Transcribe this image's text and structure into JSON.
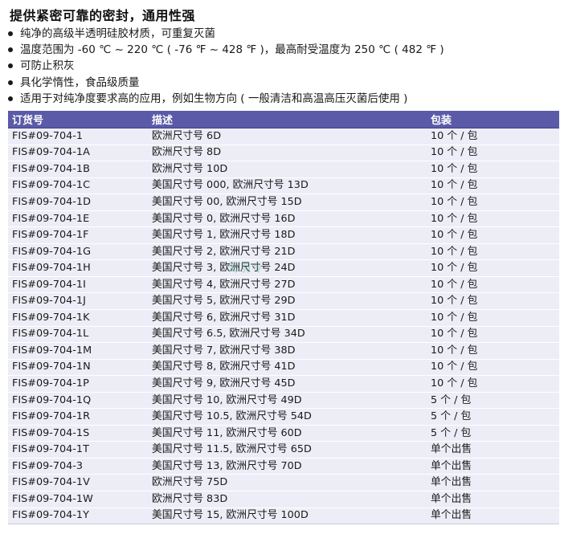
{
  "heading": "提供紧密可靠的密封，通用性强",
  "bullets": [
    "纯净的高级半透明硅胶材质，可重复灭菌",
    "温度范围为 -60 ℃ ~ 220 ℃ ( -76 ℉ ~ 428 ℉ )，最高耐受温度为 250 ℃ ( 482 ℉ )",
    "可防止积灰",
    "具化学惰性，食品级质量",
    "适用于对纯净度要求高的应用，例如生物方向 ( 一般清洁和高温高压灭菌后使用 )"
  ],
  "table": {
    "headers": [
      "订货号",
      "描述",
      "包装"
    ],
    "rows": [
      [
        "FIS#09-704-1",
        "欧洲尺寸号 6D",
        "10 个 / 包"
      ],
      [
        "FIS#09-704-1A",
        "欧洲尺寸号 8D",
        "10 个 / 包"
      ],
      [
        "FIS#09-704-1B",
        "欧洲尺寸号 10D",
        "10 个 / 包"
      ],
      [
        "FIS#09-704-1C",
        "美国尺寸号 000, 欧洲尺寸号 13D",
        "10 个 / 包"
      ],
      [
        "FIS#09-704-1D",
        "美国尺寸号 00, 欧洲尺寸号 15D",
        "10 个 / 包"
      ],
      [
        "FIS#09-704-1E",
        "美国尺寸号 0, 欧洲尺寸号 16D",
        "10 个 / 包"
      ],
      [
        "FIS#09-704-1F",
        "美国尺寸号 1, 欧洲尺寸号 18D",
        "10 个 / 包"
      ],
      [
        "FIS#09-704-1G",
        "美国尺寸号 2, 欧洲尺寸号 21D",
        "10 个 / 包"
      ],
      [
        "FIS#09-704-1H",
        "美国尺寸号 3, 欧洲尺寸号 24D",
        "10 个 / 包"
      ],
      [
        "FIS#09-704-1I",
        "美国尺寸号 4, 欧洲尺寸号 27D",
        "10 个 / 包"
      ],
      [
        "FIS#09-704-1J",
        "美国尺寸号 5, 欧洲尺寸号 29D",
        "10 个 / 包"
      ],
      [
        "FIS#09-704-1K",
        "美国尺寸号 6, 欧洲尺寸号 31D",
        "10 个 / 包"
      ],
      [
        "FIS#09-704-1L",
        "美国尺寸号 6.5, 欧洲尺寸号 34D",
        "10 个 / 包"
      ],
      [
        "FIS#09-704-1M",
        "美国尺寸号 7, 欧洲尺寸号 38D",
        "10 个 / 包"
      ],
      [
        "FIS#09-704-1N",
        "美国尺寸号 8, 欧洲尺寸号 41D",
        "10 个 / 包"
      ],
      [
        "FIS#09-704-1P",
        "美国尺寸号 9, 欧洲尺寸号 45D",
        "10 个 / 包"
      ],
      [
        "FIS#09-704-1Q",
        "美国尺寸号 10, 欧洲尺寸号 49D",
        "5 个 / 包"
      ],
      [
        "FIS#09-704-1R",
        "美国尺寸号 10.5, 欧洲尺寸号 54D",
        "5 个 / 包"
      ],
      [
        "FIS#09-704-1S",
        "美国尺寸号 11, 欧洲尺寸号 60D",
        "5 个 / 包"
      ],
      [
        "FIS#09-704-1T",
        "美国尺寸号 11.5, 欧洲尺寸号 65D",
        "单个出售"
      ],
      [
        "FIS#09-704-3",
        "美国尺寸号 13, 欧洲尺寸号 70D",
        "单个出售"
      ],
      [
        "FIS#09-704-1V",
        "欧洲尺寸号 75D",
        "单个出售"
      ],
      [
        "FIS#09-704-1W",
        "欧洲尺寸号 83D",
        "单个出售"
      ],
      [
        "FIS#09-704-1Y",
        "美国尺寸号 15, 欧洲尺寸号 100D",
        "单个出售"
      ]
    ]
  },
  "watermark": "海羽令",
  "colors": {
    "header_bg": "#5a5aa8",
    "row_bg": "#ededf7"
  }
}
